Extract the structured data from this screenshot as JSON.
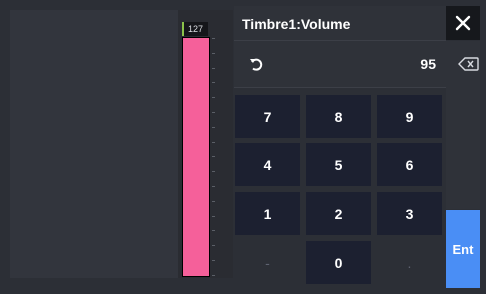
{
  "meter": {
    "value_label": "127",
    "fill_fraction": 1.0,
    "fill_color": "#f5609a",
    "indicator_color": "#8bc34a"
  },
  "title": "Timbre1:Volume",
  "close_label": "✕",
  "current_value": "95",
  "keypad": {
    "row1": [
      "7",
      "8",
      "9"
    ],
    "row2": [
      "4",
      "5",
      "6"
    ],
    "row3": [
      "1",
      "2",
      "3"
    ],
    "row4": [
      "-",
      "0",
      "."
    ],
    "enter_label": "Ent"
  },
  "colors": {
    "key_bg": "#1c2030",
    "enter_bg": "#4a8ef5"
  }
}
